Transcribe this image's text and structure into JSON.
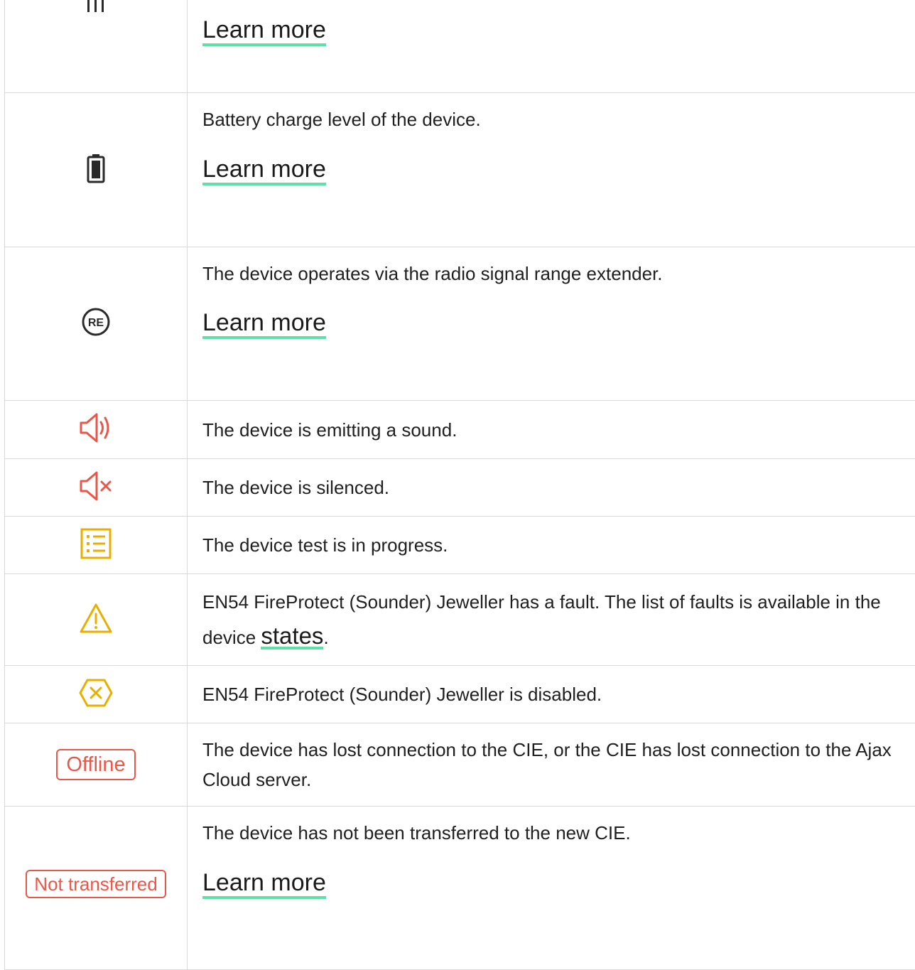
{
  "colors": {
    "link_underline": "#5fe0a6",
    "red": "#e8584a",
    "yellow": "#e7b000",
    "dark": "#2a2a2a",
    "border": "#d9d9d9"
  },
  "rows": [
    {
      "icon": "signal-strength-icon",
      "description": "",
      "learn_more": "Learn more"
    },
    {
      "icon": "battery-icon",
      "description": "Battery charge level of the device.",
      "learn_more": "Learn more"
    },
    {
      "icon": "range-extender-icon",
      "icon_text": "RE",
      "description": "The device operates via the radio signal range extender.",
      "learn_more": "Learn more"
    },
    {
      "icon": "speaker-sound-icon",
      "description": "The device is emitting a sound."
    },
    {
      "icon": "speaker-muted-icon",
      "description": "The device is silenced."
    },
    {
      "icon": "test-list-icon",
      "description": "The device test is in progress."
    },
    {
      "icon": "warning-triangle-icon",
      "description_before_link": "EN54 FireProtect (Sounder) Jeweller has a fault. The list of faults is available in the device ",
      "link": "states",
      "description_after_link": "."
    },
    {
      "icon": "disabled-octagon-icon",
      "description": "EN54 FireProtect (Sounder) Jeweller is disabled."
    },
    {
      "icon": "offline-badge",
      "badge": "Offline",
      "description": "The device has lost connection to the CIE, or the CIE has lost connection to the Ajax Cloud server."
    },
    {
      "icon": "not-transferred-badge",
      "badge": "Not transferred",
      "description": "The device has not been transferred to the new CIE.",
      "learn_more": "Learn more"
    }
  ]
}
